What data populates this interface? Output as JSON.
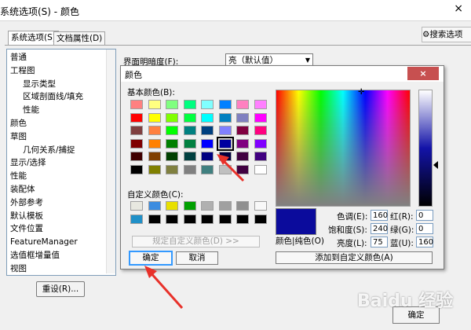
{
  "window": {
    "title": "系统选项(S) - 颜色",
    "close_glyph": "×"
  },
  "tabs": [
    {
      "label": "系统选项(S)"
    },
    {
      "label": "文档属性(D)"
    }
  ],
  "search": {
    "placeholder": "搜索选项"
  },
  "tree": [
    {
      "label": "普通",
      "level": 1
    },
    {
      "label": "工程图",
      "level": 1
    },
    {
      "label": "显示类型",
      "level": 2
    },
    {
      "label": "区域剖面线/填充",
      "level": 2
    },
    {
      "label": "性能",
      "level": 2
    },
    {
      "label": "颜色",
      "level": 1
    },
    {
      "label": "草图",
      "level": 1
    },
    {
      "label": "几何关系/捕捉",
      "level": 2
    },
    {
      "label": "显示/选择",
      "level": 1
    },
    {
      "label": "性能",
      "level": 1
    },
    {
      "label": "装配体",
      "level": 1
    },
    {
      "label": "外部参考",
      "level": 1
    },
    {
      "label": "默认模板",
      "level": 1
    },
    {
      "label": "文件位置",
      "level": 1
    },
    {
      "label": "FeatureManager",
      "level": 1
    },
    {
      "label": "选值框增量值",
      "level": 1
    },
    {
      "label": "视图",
      "level": 1
    }
  ],
  "theme": {
    "label": "界面明暗度(F):",
    "value": "亮（默认值）"
  },
  "reset_label": "重设(R)...",
  "ok_main_label": "确定",
  "color_dialog": {
    "title": "颜色",
    "close_glyph": "×",
    "basic_label": "基本颜色(B):",
    "custom_label": "自定义颜色(C):",
    "define_custom_label": "规定自定义颜色(D) >>",
    "ok_label": "确定",
    "cancel_label": "取消",
    "solid_label": "颜色|纯色(O)",
    "hue_label": "色调(E):",
    "sat_label": "饱和度(S):",
    "lum_label": "亮度(L):",
    "red_label": "红(R):",
    "green_label": "绿(G):",
    "blue_label": "蓝(U):",
    "hue": "160",
    "sat": "240",
    "lum": "75",
    "red": "0",
    "green": "0",
    "blue": "160",
    "add_custom_label": "添加到自定义颜色(A)",
    "selected_color": "#0b0b9c",
    "basic_colors": [
      [
        "#ff8080",
        "#ffff80",
        "#80ff80",
        "#00ff80",
        "#80ffff",
        "#0080ff",
        "#ff80c0",
        "#ff80ff"
      ],
      [
        "#ff0000",
        "#ffff00",
        "#80ff00",
        "#00ff40",
        "#00ffff",
        "#0080c0",
        "#8080c0",
        "#ff00ff"
      ],
      [
        "#804040",
        "#ff8040",
        "#00ff00",
        "#008080",
        "#004080",
        "#8080ff",
        "#800040",
        "#ff0080"
      ],
      [
        "#800000",
        "#ff8000",
        "#008000",
        "#008040",
        "#0000ff",
        "#0000a0",
        "#800080",
        "#8000ff"
      ],
      [
        "#400000",
        "#804000",
        "#004000",
        "#004040",
        "#000080",
        "#000040",
        "#400040",
        "#400080"
      ],
      [
        "#000000",
        "#808000",
        "#808040",
        "#808080",
        "#408080",
        "#c0c0c0",
        "#400040",
        "#ffffff"
      ]
    ],
    "custom_colors": [
      [
        "#e8e8e0",
        "#3c8ce0",
        "#e8e000",
        "#00a000",
        "#b0b0b0",
        "#a0a0a0",
        "#909090",
        "#f8f8f8"
      ],
      [
        "#2090c8",
        "#000000",
        "#000000",
        "#000000",
        "#000000",
        "#000000",
        "#000000",
        "#000000"
      ]
    ]
  },
  "watermark": "Baidu 经验",
  "colors": {
    "accent_arrow": "#e8312a",
    "close_red": "#c75050"
  }
}
